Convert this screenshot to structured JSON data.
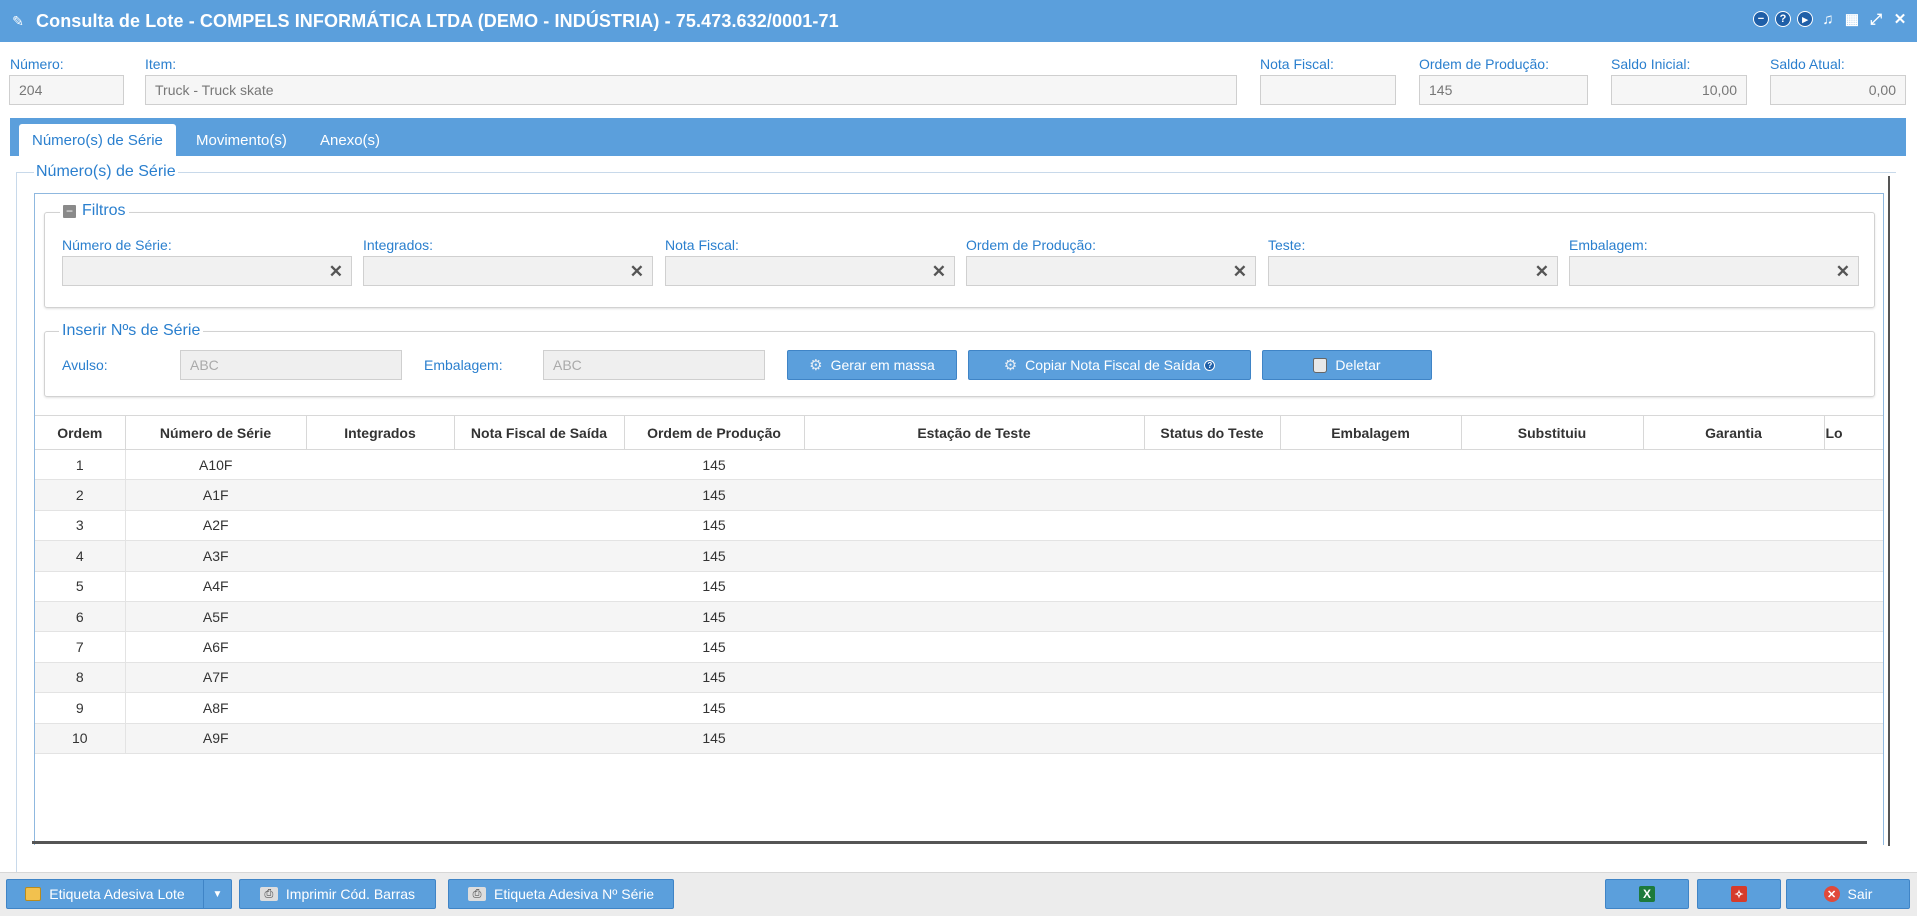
{
  "window": {
    "title": "Consulta de Lote - COMPELS INFORMÁTICA LTDA (DEMO - INDÚSTRIA) - 75.473.632/0001-71",
    "actions": [
      "minimize-icon",
      "help-icon",
      "play-icon",
      "bell-icon",
      "calendar-icon",
      "collapse-icon",
      "close-icon"
    ]
  },
  "header": {
    "numero_label": "Número:",
    "numero_value": "204",
    "item_label": "Item:",
    "item_value": "Truck - Truck skate",
    "nota_fiscal_label": "Nota Fiscal:",
    "nota_fiscal_value": "",
    "ordem_producao_label": "Ordem de Produção:",
    "ordem_producao_value": "145",
    "saldo_inicial_label": "Saldo Inicial:",
    "saldo_inicial_value": "10,00",
    "saldo_atual_label": "Saldo Atual:",
    "saldo_atual_value": "0,00"
  },
  "tabs": [
    {
      "label": "Número(s) de Série",
      "active": true
    },
    {
      "label": "Movimento(s)",
      "active": false
    },
    {
      "label": "Anexo(s)",
      "active": false
    }
  ],
  "panel": {
    "title": "Número(s) de Série"
  },
  "filters": {
    "title": "Filtros",
    "fields": [
      {
        "label": "Número de Série:",
        "value": ""
      },
      {
        "label": "Integrados:",
        "value": ""
      },
      {
        "label": "Nota Fiscal:",
        "value": ""
      },
      {
        "label": "Ordem de Produção:",
        "value": ""
      },
      {
        "label": "Teste:",
        "value": ""
      },
      {
        "label": "Embalagem:",
        "value": ""
      }
    ]
  },
  "insert": {
    "title": "Inserir Nºs de Série",
    "avulso_label": "Avulso:",
    "avulso_placeholder": "ABC",
    "embalagem_label": "Embalagem:",
    "embalagem_placeholder": "ABC",
    "gerar_label": "Gerar em massa",
    "copiar_label": "Copiar Nota Fiscal de Saída",
    "deletar_label": "Deletar"
  },
  "table": {
    "columns": [
      "Ordem",
      "Número de Série",
      "Integrados",
      "Nota Fiscal de Saída",
      "Ordem de Produção",
      "Estação de Teste",
      "Status do Teste",
      "Embalagem",
      "Substituiu",
      "Garantia",
      "Lo"
    ],
    "rows": [
      [
        "1",
        "A10F",
        "",
        "",
        "145",
        "",
        "",
        "",
        "",
        ""
      ],
      [
        "2",
        "A1F",
        "",
        "",
        "145",
        "",
        "",
        "",
        "",
        ""
      ],
      [
        "3",
        "A2F",
        "",
        "",
        "145",
        "",
        "",
        "",
        "",
        ""
      ],
      [
        "4",
        "A3F",
        "",
        "",
        "145",
        "",
        "",
        "",
        "",
        ""
      ],
      [
        "5",
        "A4F",
        "",
        "",
        "145",
        "",
        "",
        "",
        "",
        ""
      ],
      [
        "6",
        "A5F",
        "",
        "",
        "145",
        "",
        "",
        "",
        "",
        ""
      ],
      [
        "7",
        "A6F",
        "",
        "",
        "145",
        "",
        "",
        "",
        "",
        ""
      ],
      [
        "8",
        "A7F",
        "",
        "",
        "145",
        "",
        "",
        "",
        "",
        ""
      ],
      [
        "9",
        "A8F",
        "",
        "",
        "145",
        "",
        "",
        "",
        "",
        ""
      ],
      [
        "10",
        "A9F",
        "",
        "",
        "145",
        "",
        "",
        "",
        "",
        ""
      ]
    ]
  },
  "footer": {
    "etiqueta_lote_label": "Etiqueta Adesiva Lote",
    "imprimir_barras_label": "Imprimir Cód. Barras",
    "etiqueta_serie_label": "Etiqueta Adesiva Nº Série",
    "sair_label": "Sair"
  },
  "colors": {
    "accent": "#5b9fdc",
    "label": "#2a7fce"
  }
}
